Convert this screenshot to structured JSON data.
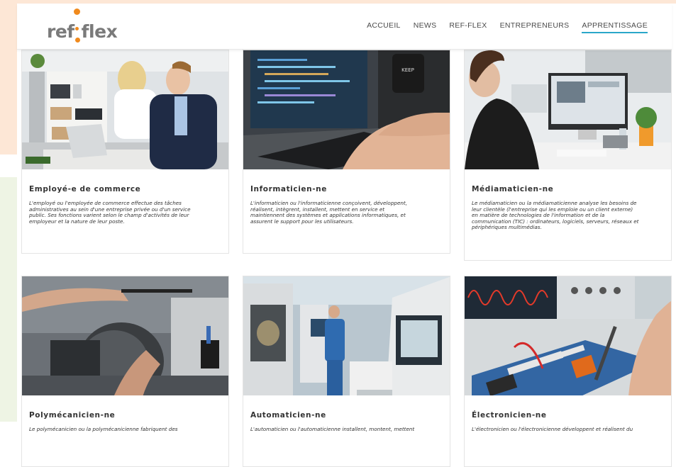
{
  "brand": {
    "logo_left": "ref",
    "logo_right": "flex",
    "accent": "#f08a1d"
  },
  "nav": {
    "items": [
      "ACCUEIL",
      "NEWS",
      "REF-FLEX",
      "ENTREPRENEURS",
      "APPRENTISSAGE"
    ],
    "active": "APPRENTISSAGE",
    "active_color": "#2aa7c9"
  },
  "cards": [
    {
      "title": "Employé-e de commerce",
      "lines": [
        "L'employé ou l'employée de commerce effectue des tâches",
        "administratives au sein d'une entreprise privée ou d'un service",
        "public. Ses fonctions varient selon le champ d'activités de leur",
        "employeur et la nature de leur poste."
      ]
    },
    {
      "title": "Informaticien-ne",
      "lines": [
        "L'informaticien ou l'informaticienne conçoivent, développent,",
        "réalisent, intègrent, installent, mettent en service et",
        "maintiennent des systèmes et applications informatiques, et",
        "assurent le support pour les utilisateurs."
      ]
    },
    {
      "title": "Médiamaticien-ne",
      "lines": [
        "Le médiamaticien ou la médiamaticienne analyse les besoins de",
        "leur clientèle (l'entreprise qui les emploie ou un client externe)",
        "en matière de technologies de l'information et de la",
        "communication (TIC) : ordinateurs, logiciels, serveurs, réseaux et",
        "périphériques multimédias."
      ]
    },
    {
      "title": "Polymécanicien-ne",
      "lines": [
        "Le polymécanicien ou la polymécanicienne fabriquent des"
      ]
    },
    {
      "title": "Automaticien-ne",
      "lines": [
        "L'automaticien ou l'automaticienne installent, montent, mettent"
      ]
    },
    {
      "title": "Électronicien-ne",
      "lines": [
        "L'électronicien ou l'électronicienne développent et réalisent du"
      ]
    }
  ]
}
